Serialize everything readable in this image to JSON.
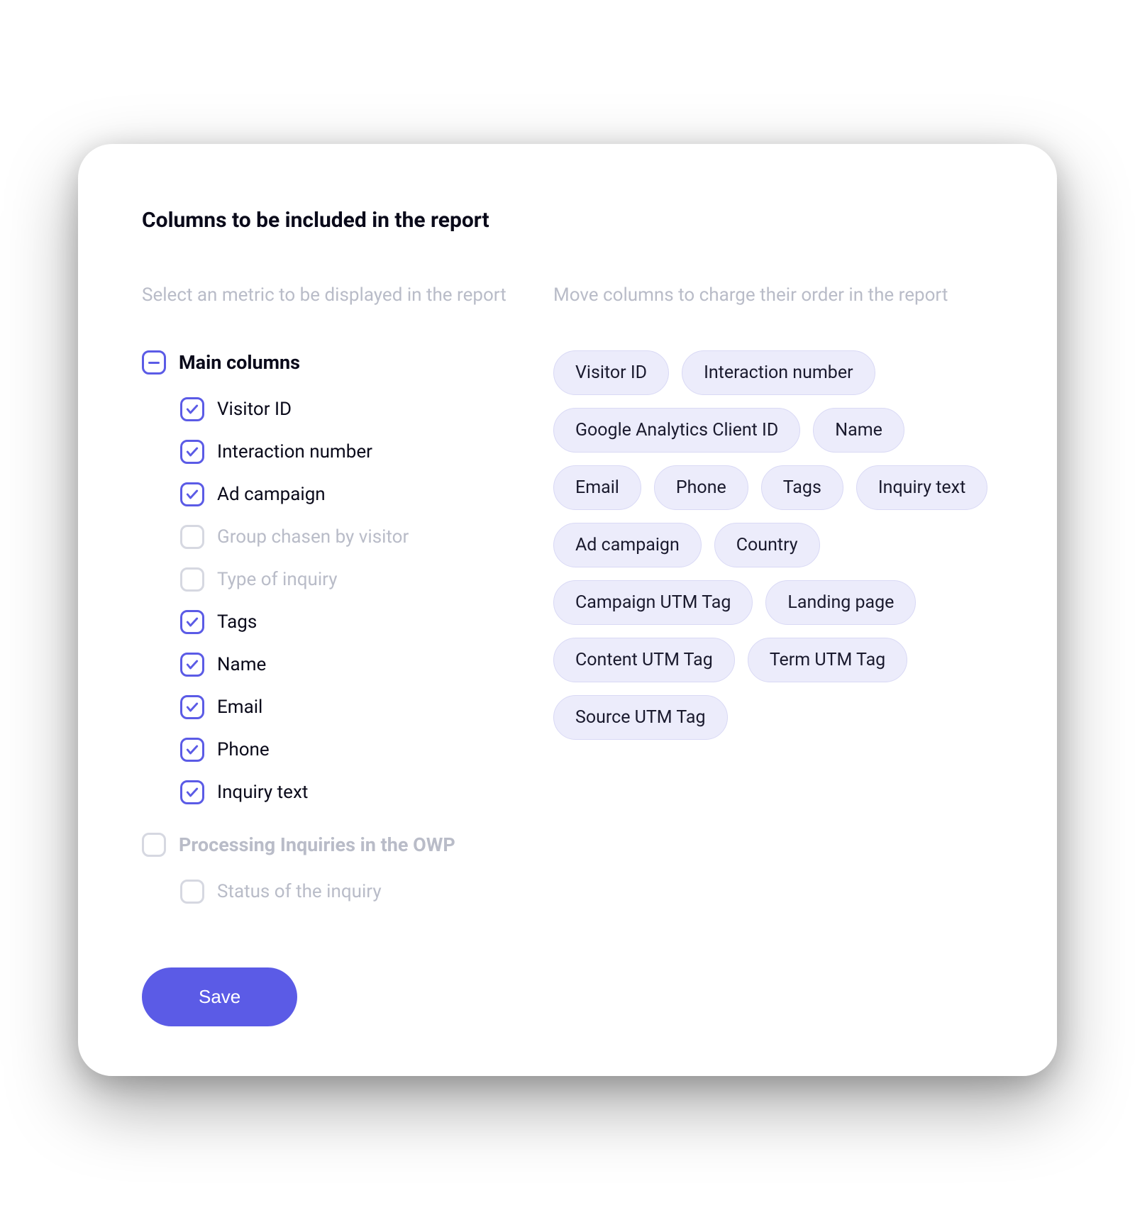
{
  "title": "Columns to be included in the report",
  "left": {
    "subtext": "Select an metric to be displayed in the report",
    "groups": [
      {
        "state": "indeterminate",
        "label": "Main columns",
        "muted": false,
        "options": [
          {
            "label": "Visitor ID",
            "checked": true
          },
          {
            "label": "Interaction number",
            "checked": true
          },
          {
            "label": "Ad campaign",
            "checked": true
          },
          {
            "label": "Group chasen by visitor",
            "checked": false
          },
          {
            "label": "Type of inquiry",
            "checked": false
          },
          {
            "label": "Tags",
            "checked": true
          },
          {
            "label": "Name",
            "checked": true
          },
          {
            "label": "Email",
            "checked": true
          },
          {
            "label": "Phone",
            "checked": true
          },
          {
            "label": "Inquiry text",
            "checked": true
          }
        ]
      },
      {
        "state": "unchecked",
        "label": "Processing Inquiries in the OWP",
        "muted": true,
        "options": [
          {
            "label": "Status of the inquiry",
            "checked": false
          }
        ]
      }
    ]
  },
  "right": {
    "subtext": "Move columns to charge their order in the report",
    "chips": [
      "Visitor ID",
      "Interaction number",
      "Google Analytics Client ID",
      "Name",
      "Email",
      "Phone",
      "Tags",
      "Inquiry text",
      "Ad campaign",
      "Country",
      "Campaign UTM Tag",
      "Landing page",
      "Content UTM Tag",
      "Term UTM Tag",
      "Source UTM Tag"
    ]
  },
  "buttons": {
    "save": "Save"
  },
  "colors": {
    "accent": "#5b5be6",
    "chip_bg": "#ececfb",
    "muted_text": "#b9bcc8"
  }
}
